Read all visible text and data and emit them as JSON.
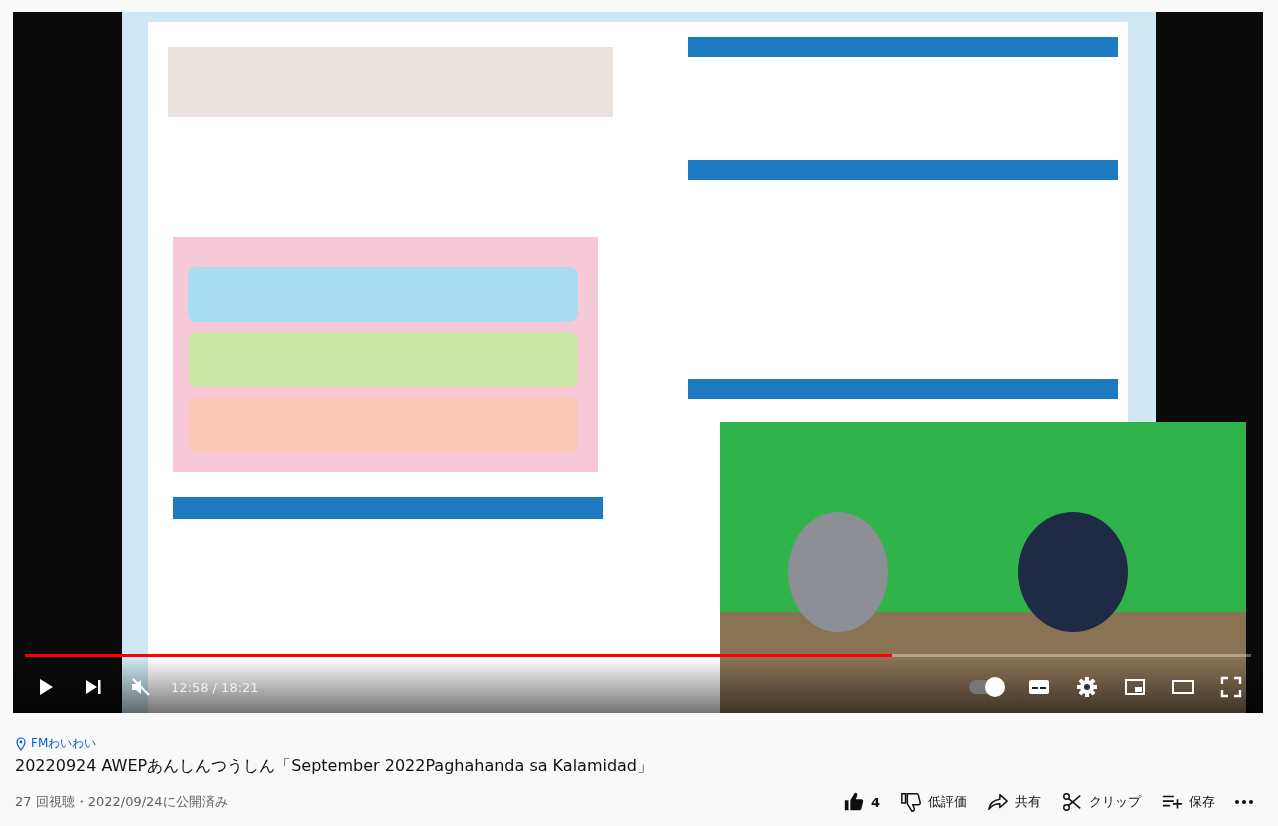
{
  "player": {
    "progress": {
      "level": 0.707
    },
    "muted": true,
    "time": "12:58 / 18:21",
    "autoplay": {
      "on": true
    }
  },
  "video": {
    "location": "FMわいわい",
    "title": "20220924 AWEPあんしんつうしん「September 2022Paghahanda sa Kalamidad」",
    "meta": "27 回視聴・2022/09/24に公開済み",
    "actions": [
      {
        "kind": "like",
        "label": "4"
      },
      {
        "kind": "dislike",
        "label": "低評価"
      },
      {
        "kind": "share",
        "label": "共有"
      },
      {
        "kind": "clip",
        "label": "クリップ"
      },
      {
        "kind": "save",
        "label": "保存"
      },
      {
        "kind": "more"
      }
    ]
  }
}
